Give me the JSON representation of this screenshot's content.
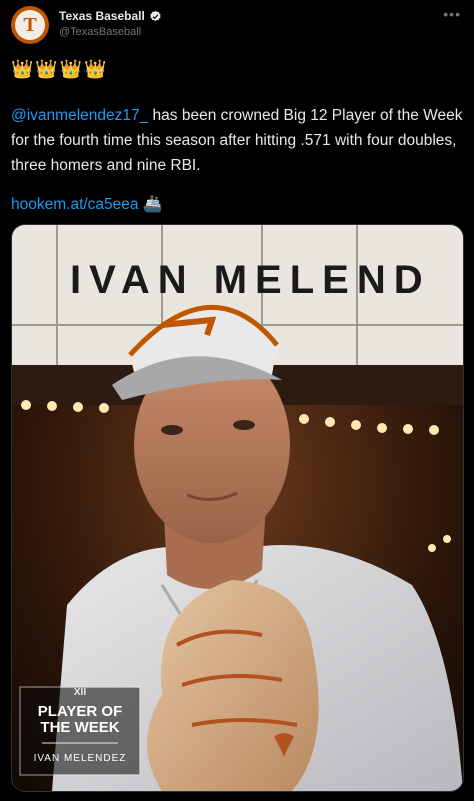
{
  "tweet": {
    "display_name": "Texas Baseball",
    "handle": "@TexasBaseball",
    "avatar_letter": "T",
    "emoji_line": "👑👑👑👑",
    "mention": "@ivanmelendez17_",
    "body": " has been crowned Big 12 Player of the Week for the fourth time this season after hitting .571 with four doubles, three homers and nine RBI.",
    "link": "hookem.at/ca5eea",
    "link_emoji": "🚢"
  },
  "image": {
    "marquee_text": "IVAN MELEND",
    "badge_conference": "XII",
    "badge_title_line1": "PLAYER OF",
    "badge_title_line2": "THE WEEK",
    "badge_player": "IVAN MELENDEZ"
  },
  "colors": {
    "brand": "#bf5700",
    "link": "#1d9bf0",
    "background": "#000000"
  }
}
